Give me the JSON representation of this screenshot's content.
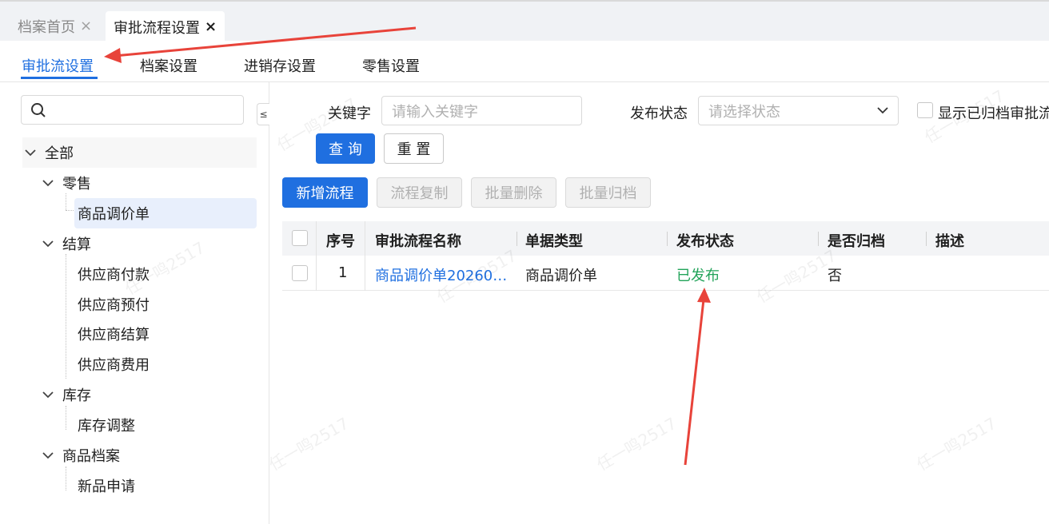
{
  "window_tabs": [
    {
      "label": "档案首页",
      "close": "×"
    },
    {
      "label": "审批流程设置",
      "close": "×"
    }
  ],
  "sub_tabs": [
    "审批流设置",
    "档案设置",
    "进销存设置",
    "零售设置"
  ],
  "sidebar": {
    "collapse_glyph": "≤",
    "tree": {
      "root": "全部",
      "groups": [
        {
          "label": "零售",
          "children": [
            "商品调价单"
          ]
        },
        {
          "label": "结算",
          "children": [
            "供应商付款",
            "供应商预付",
            "供应商结算",
            "供应商费用"
          ]
        },
        {
          "label": "库存",
          "children": [
            "库存调整"
          ]
        },
        {
          "label": "商品档案",
          "children": [
            "新品申请"
          ]
        }
      ]
    }
  },
  "filters": {
    "keyword_label": "关键字",
    "keyword_placeholder": "请输入关键字",
    "status_label": "发布状态",
    "status_placeholder": "请选择状态",
    "show_archived_label": "显示已归档审批流"
  },
  "buttons": {
    "query": "查 询",
    "reset": "重 置",
    "add": "新增流程",
    "copy": "流程复制",
    "batch_delete": "批量删除",
    "batch_archive": "批量归档"
  },
  "table": {
    "columns": [
      "序号",
      "审批流程名称",
      "单据类型",
      "发布状态",
      "是否归档",
      "描述"
    ],
    "rows": [
      {
        "index": "1",
        "name": "商品调价单20260…",
        "doc_type": "商品调价单",
        "status": "已发布",
        "archived": "否",
        "desc": ""
      }
    ]
  },
  "colors": {
    "accent": "#1f6fe0",
    "status_published": "#22a35a",
    "annotation_arrow": "#e8433a"
  },
  "watermark": "任一鸣2517"
}
